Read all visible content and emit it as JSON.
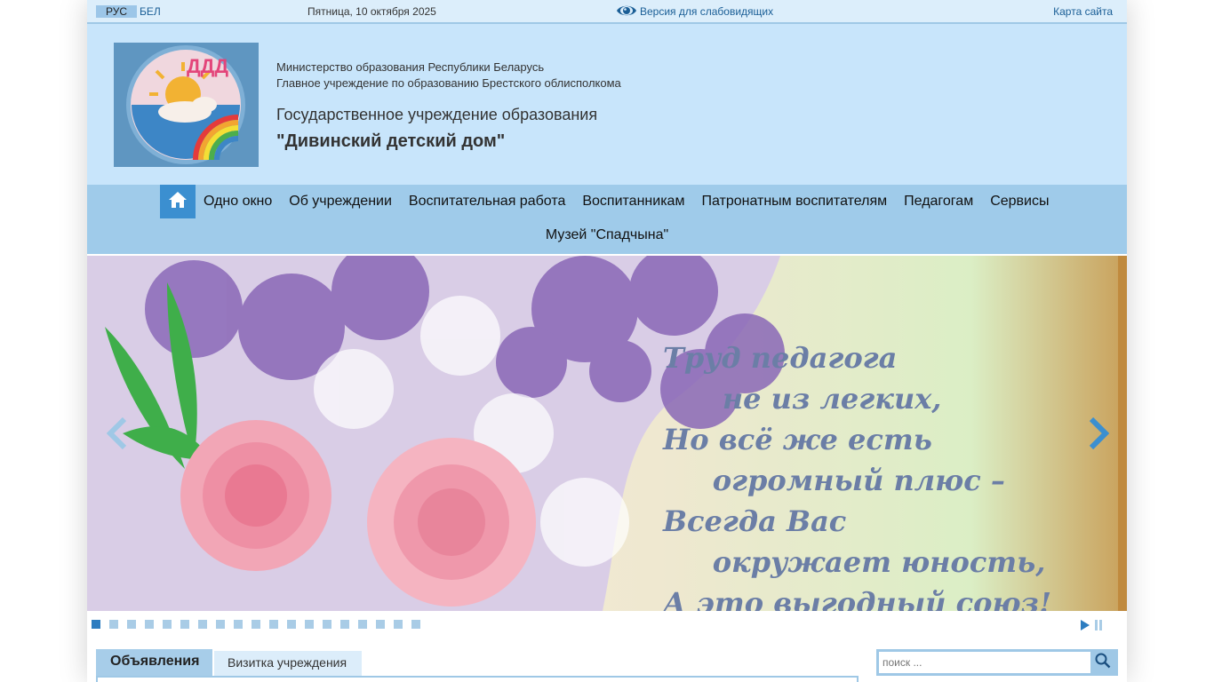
{
  "topbar": {
    "lang_ru": "РУС",
    "lang_be": "БЕЛ",
    "date": "Пятница, 10 октября 2025",
    "vision_link": "Версия для слабовидящих",
    "sitemap": "Карта сайта"
  },
  "header": {
    "ministry": "Министерство образования Республики Беларусь",
    "department": "Главное учреждение по образованию Брестского облисполкома",
    "inst_type": "Государственное учреждение образования",
    "inst_name": "\"Дивинский детский дом\"",
    "logo_letters": "ДДД"
  },
  "nav": {
    "items": [
      {
        "label": "Одно окно"
      },
      {
        "label": "Об учреждении"
      },
      {
        "label": "Воспитательная работа"
      },
      {
        "label": "Воспитанникам"
      },
      {
        "label": "Патронатным воспитателям"
      },
      {
        "label": "Педагогам"
      },
      {
        "label": "Сервисы"
      }
    ],
    "row2": "Музей \"Спадчына\""
  },
  "slider": {
    "text": "Труд педагога\n      не из легких,\nНо всё же есть\n     огромный плюс –\nВсегда Вас\n     окружает юность,\nА это выгодный союз!",
    "dots_total": 19,
    "active_dot": 1
  },
  "tabs": [
    {
      "label": "Объявления"
    },
    {
      "label": "Визитка учреждения"
    }
  ],
  "search": {
    "placeholder": "поиск ..."
  },
  "colors": {
    "topbar_bg": "#dceefb",
    "header_bg": "#c8e5fb",
    "nav_bg": "#9fcbea",
    "accent": "#3b8fd0",
    "link": "#1a5e96"
  }
}
